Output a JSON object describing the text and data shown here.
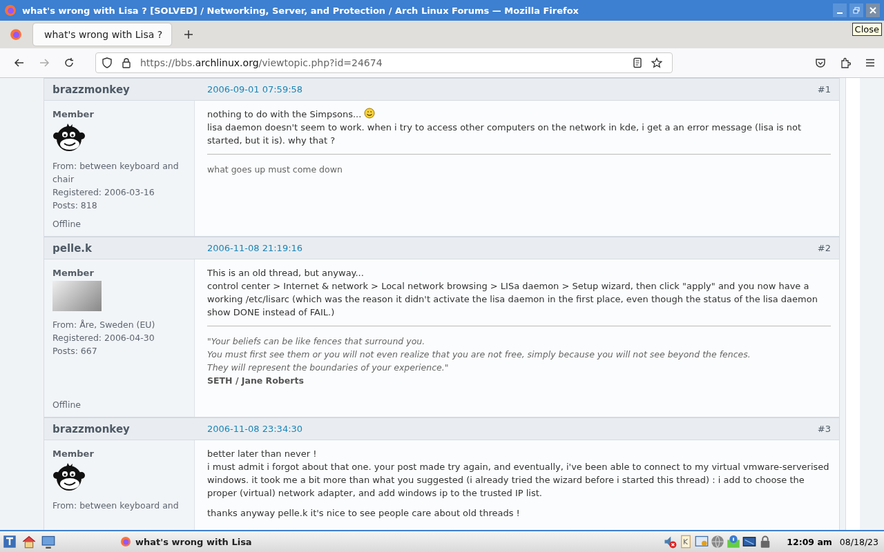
{
  "window": {
    "title": "what's wrong with Lisa ? [SOLVED] / Networking, Server, and Protection / Arch Linux Forums — Mozilla Firefox",
    "tooltip": "Close"
  },
  "tabs": [
    {
      "label": "what's wrong with Lisa ?",
      "selected": true
    }
  ],
  "address": {
    "prefix": "https://bbs.",
    "domain": "archlinux.org",
    "path": "/viewtopic.php?id=24674"
  },
  "posts": [
    {
      "author": "brazzmonkey",
      "time": "2006-09-01 07:59:58",
      "number": "#1",
      "rank": "Member",
      "avatar": {
        "kind": "monkey"
      },
      "info": [
        "From: between keyboard and chair",
        "Registered: 2006-03-16",
        "Posts: 818"
      ],
      "status": "Offline",
      "message": [
        {
          "lines": [
            {
              "text": "nothing to do with the Simpsons...",
              "smiley": true
            },
            {
              "text": "lisa daemon doesn't seem to work. when i try to access other computers on the network in kde, i get a an error message (lisa is not started, but it is). why that ?",
              "smiley": false
            }
          ]
        }
      ],
      "signature": {
        "kind": "plain",
        "lines": [
          "what goes up must come down"
        ]
      }
    },
    {
      "author": "pelle.k",
      "time": "2006-11-08 21:19:16",
      "number": "#2",
      "rank": "Member",
      "avatar": {
        "kind": "photo"
      },
      "info": [
        "From: Åre, Sweden (EU)",
        "Registered: 2006-04-30",
        "Posts: 667"
      ],
      "status": "Offline",
      "message": [
        {
          "lines": [
            {
              "text": "This is an old thread, but anyway...",
              "smiley": false
            },
            {
              "text": "control center > Internet & network > Local network browsing > LISa daemon > Setup wizard, then click \"apply\" and you now have a working /etc/lisarc (which was the reason it didn't activate the lisa daemon in the first place, even though the status of the lisa daemon show DONE instead of FAIL.)",
              "smiley": false
            }
          ]
        }
      ],
      "signature": {
        "kind": "quote",
        "lines": [
          "\"Your beliefs can be like fences that surround you.",
          "You must first see them or you will not even realize that you are not free, simply because you will not see beyond the fences.",
          "They will represent the boundaries of your experience.\""
        ],
        "author": "SETH / Jane Roberts"
      }
    },
    {
      "author": "brazzmonkey",
      "time": "2006-11-08 23:34:30",
      "number": "#3",
      "rank": "Member",
      "avatar": {
        "kind": "monkey"
      },
      "info": [
        "From: between keyboard and"
      ],
      "message": [
        {
          "lines": [
            {
              "text": "better later than never !",
              "smiley": false
            },
            {
              "text": "i must admit i forgot about that one. your post made try again, and eventually, i've been able to connect to my virtual vmware-serverised windows. it took me a bit more than what you suggested (i already tried the wizard before i started this thread) : i add to choose the proper (virtual) network adapter, and add windows ip to the trusted IP list.",
              "smiley": false
            }
          ]
        },
        {
          "lines": [
            {
              "text": "thanks anyway pelle.k it's nice to see people care about old threads !",
              "smiley": false
            }
          ]
        }
      ]
    }
  ],
  "taskbar": {
    "task": "what's wrong with Lisa",
    "time": "12:09 am",
    "date": "08/18/23"
  }
}
